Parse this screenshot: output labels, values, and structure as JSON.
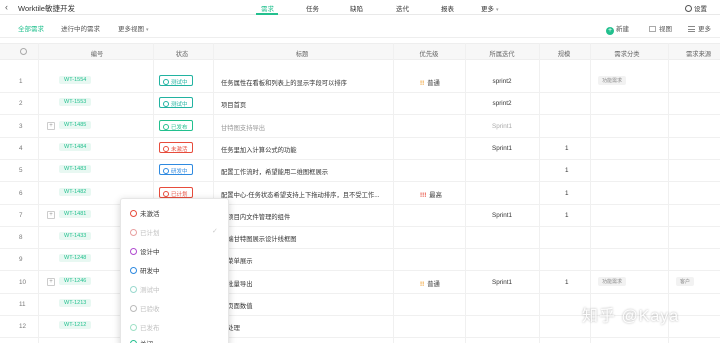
{
  "app": {
    "back_glyph": "‹",
    "title": "Worktile敏捷开发"
  },
  "topnav": [
    {
      "label": "需求",
      "active": true
    },
    {
      "label": "任务",
      "active": false
    },
    {
      "label": "缺陷",
      "active": false
    },
    {
      "label": "迭代",
      "active": false
    },
    {
      "label": "报表",
      "active": false
    },
    {
      "label": "更多",
      "active": false
    }
  ],
  "settings_label": "设置",
  "subtabs": [
    {
      "label": "全部需求",
      "active": true
    },
    {
      "label": "进行中的需求",
      "active": false
    },
    {
      "label": "更多视图",
      "active": false
    }
  ],
  "tools": {
    "new_label": "新建",
    "view_label": "视图",
    "more_label": "更多"
  },
  "columns": [
    "编号",
    "状态",
    "标题",
    "优先级",
    "所属迭代",
    "规模",
    "需求分类",
    "需求来源"
  ],
  "statuses": {
    "testing": {
      "label": "测试中",
      "color": "#22b3a1"
    },
    "released": {
      "label": "已发布",
      "color": "#22c08e"
    },
    "not_activated": {
      "label": "未激活",
      "color": "#e74c3c"
    },
    "developing": {
      "label": "研发中",
      "color": "#2f8ae0"
    },
    "planned": {
      "label": "已计划",
      "color": "#e74c3c"
    }
  },
  "rows": [
    {
      "idx": "1",
      "id": "WT-1554",
      "status": "测试中",
      "title": "任务属性在看板和列表上的显示字段可以排序",
      "priority": "普通",
      "sprint": "sprint2",
      "scale": "",
      "category": "功能需求",
      "source": ""
    },
    {
      "idx": "2",
      "id": "WT-1553",
      "status": "测试中",
      "title": "项目首页",
      "priority": "",
      "sprint": "sprint2",
      "scale": "",
      "category": "",
      "source": ""
    },
    {
      "idx": "3",
      "id": "WT-1485",
      "status": "已发布",
      "title": "甘特图支持导出",
      "priority": "",
      "sprint": "Sprint1",
      "scale": "",
      "category": "",
      "source": ""
    },
    {
      "idx": "4",
      "id": "WT-1484",
      "status": "未激活",
      "title": "任务里加入计算公式的功能",
      "priority": "",
      "sprint": "Sprint1",
      "scale": "1",
      "category": "",
      "source": ""
    },
    {
      "idx": "5",
      "id": "WT-1483",
      "status": "研发中",
      "title": "配置工作流时，希望能用二维图框展示",
      "priority": "",
      "sprint": "",
      "scale": "1",
      "category": "",
      "source": ""
    },
    {
      "idx": "6",
      "id": "WT-1482",
      "status": "已计划",
      "title": "配置中心-任务状态希望支持上下拖动排序，且不受工作...",
      "priority": "最高",
      "sprint": "",
      "scale": "1",
      "category": "",
      "source": ""
    },
    {
      "idx": "7",
      "id": "WT-1481",
      "status": "",
      "title": "加项目内文件管理的组件",
      "priority": "",
      "sprint": "Sprint1",
      "scale": "1",
      "category": "",
      "source": ""
    },
    {
      "idx": "8",
      "id": "WT-1433",
      "status": "",
      "title": "动端甘特图展示设计线框图",
      "priority": "",
      "sprint": "",
      "scale": "",
      "category": "",
      "source": ""
    },
    {
      "idx": "9",
      "id": "WT-1248",
      "status": "",
      "title": "拉菜单展示",
      "priority": "",
      "sprint": "",
      "scale": "",
      "category": "",
      "source": ""
    },
    {
      "idx": "10",
      "id": "WT-1246",
      "status": "",
      "title": "务批量导出",
      "priority": "普通",
      "sprint": "Sprint1",
      "scale": "1",
      "category": "功能需求",
      "source": "客户"
    },
    {
      "idx": "11",
      "id": "WT-1213",
      "status": "",
      "title": "表页面数值",
      "priority": "",
      "sprint": "",
      "scale": "",
      "category": "",
      "source": ""
    },
    {
      "idx": "12",
      "id": "WT-1212",
      "status": "",
      "title": "量处理",
      "priority": "",
      "sprint": "",
      "scale": "",
      "category": "",
      "source": ""
    }
  ],
  "dropdown": [
    {
      "label": "未激活",
      "color": "#e74c3c",
      "disabled": false
    },
    {
      "label": "已计划",
      "color": "#e8a0a0",
      "disabled": true
    },
    {
      "label": "设计中",
      "color": "#b04ad0",
      "disabled": false
    },
    {
      "label": "研发中",
      "color": "#2f8ae0",
      "disabled": false
    },
    {
      "label": "测试中",
      "color": "#9ad9ce",
      "disabled": true
    },
    {
      "label": "已验收",
      "color": "#bbbbbb",
      "disabled": true
    },
    {
      "label": "已发布",
      "color": "#9fe0c6",
      "disabled": true
    },
    {
      "label": "关闭",
      "color": "#22c08e",
      "disabled": false
    }
  ],
  "dropdown_check": "✓",
  "watermark": "知乎 @Kaya"
}
